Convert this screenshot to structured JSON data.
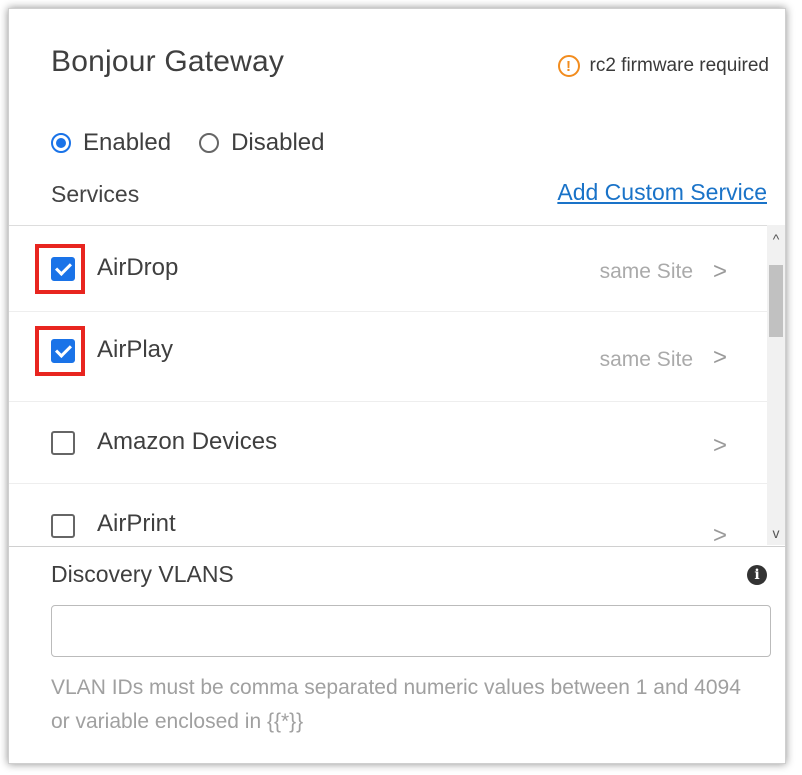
{
  "panel": {
    "title": "Bonjour Gateway",
    "firmware_warning": "rc2 firmware required",
    "warning_icon": "!"
  },
  "mode": {
    "options": [
      {
        "label": "Enabled",
        "selected": true
      },
      {
        "label": "Disabled",
        "selected": false
      }
    ]
  },
  "services": {
    "label": "Services",
    "add_custom_label": "Add Custom Service",
    "items": [
      {
        "label": "AirDrop",
        "checked": true,
        "scope": "same Site"
      },
      {
        "label": "AirPlay",
        "checked": true,
        "scope": "same Site"
      },
      {
        "label": "Amazon Devices",
        "checked": false,
        "scope": ""
      },
      {
        "label": "AirPrint",
        "checked": false,
        "scope": ""
      }
    ],
    "chevron": ">"
  },
  "scroll": {
    "up": "^",
    "down": "v"
  },
  "discovery": {
    "label": "Discovery VLANS",
    "value": "",
    "hint": "VLAN IDs must be comma separated numeric values between 1 and 4094 or variable enclosed in {{*}}",
    "info_icon": "i"
  },
  "colors": {
    "accent": "#1a73e8",
    "warning": "#f28c1e",
    "highlight": "#e8251f",
    "link": "#1a73c8"
  }
}
